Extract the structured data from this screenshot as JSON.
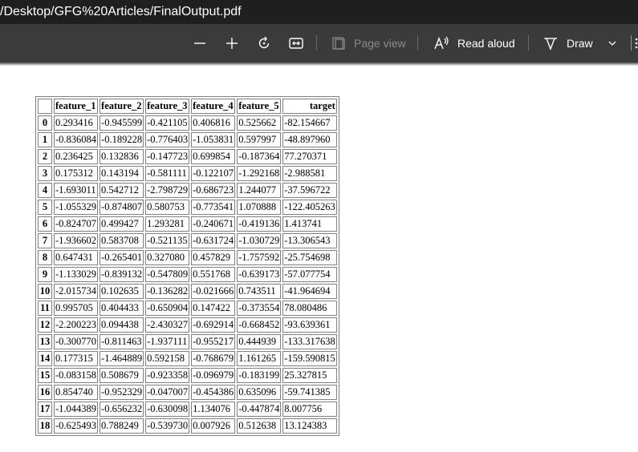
{
  "window": {
    "title": "/Desktop/GFG%20Articles/FinalOutput.pdf"
  },
  "toolbar": {
    "zoom_out_icon": "minus-icon",
    "zoom_in_icon": "plus-icon",
    "rotate_icon": "rotate-icon",
    "fit_icon": "fit-width-icon",
    "page_view_label": "Page view",
    "read_aloud_label": "Read aloud",
    "draw_label": "Draw"
  },
  "table": {
    "columns": [
      "",
      "feature_1",
      "feature_2",
      "feature_3",
      "feature_4",
      "feature_5",
      "target"
    ],
    "rows": [
      [
        "0",
        "0.293416",
        "-0.945599",
        "-0.421105",
        "0.406816",
        "0.525662",
        "-82.154667"
      ],
      [
        "1",
        "-0.836084",
        "-0.189228",
        "-0.776403",
        "-1.053831",
        "0.597997",
        "-48.897960"
      ],
      [
        "2",
        "0.236425",
        "0.132836",
        "-0.147723",
        "0.699854",
        "-0.187364",
        "77.270371"
      ],
      [
        "3",
        "0.175312",
        "0.143194",
        "-0.581111",
        "-0.122107",
        "-1.292168",
        "-2.988581"
      ],
      [
        "4",
        "-1.693011",
        "0.542712",
        "-2.798729",
        "-0.686723",
        "1.244077",
        "-37.596722"
      ],
      [
        "5",
        "-1.055329",
        "-0.874807",
        "0.580753",
        "-0.773541",
        "1.070888",
        "-122.405263"
      ],
      [
        "6",
        "-0.824707",
        "0.499427",
        "1.293281",
        "-0.240671",
        "-0.419136",
        "1.413741"
      ],
      [
        "7",
        "-1.936602",
        "0.583708",
        "-0.521135",
        "-0.631724",
        "-1.030729",
        "-13.306543"
      ],
      [
        "8",
        "0.647431",
        "-0.265401",
        "0.327080",
        "0.457829",
        "-1.757592",
        "-25.754698"
      ],
      [
        "9",
        "-1.133029",
        "-0.839132",
        "-0.547809",
        "0.551768",
        "-0.639173",
        "-57.077754"
      ],
      [
        "10",
        "-2.015734",
        "0.102635",
        "-0.136282",
        "-0.021666",
        "0.743511",
        "-41.964694"
      ],
      [
        "11",
        "0.995705",
        "0.404433",
        "-0.650904",
        "0.147422",
        "-0.373554",
        "78.080486"
      ],
      [
        "12",
        "-2.200223",
        "0.094438",
        "-2.430327",
        "-0.692914",
        "-0.668452",
        "-93.639361"
      ],
      [
        "13",
        "-0.300770",
        "-0.811463",
        "-1.937111",
        "-0.955217",
        "0.444939",
        "-133.317638"
      ],
      [
        "14",
        "0.177315",
        "-1.464889",
        "0.592158",
        "-0.768679",
        "1.161265",
        "-159.590815"
      ],
      [
        "15",
        "-0.083158",
        "0.508679",
        "-0.923358",
        "-0.096979",
        "-0.183199",
        "25.327815"
      ],
      [
        "16",
        "0.854740",
        "-0.952329",
        "-0.047007",
        "-0.454386",
        "0.635096",
        "-59.741385"
      ],
      [
        "17",
        "-1.044389",
        "-0.656232",
        "-0.630098",
        "1.134076",
        "-0.447874",
        "8.007756"
      ],
      [
        "18",
        "-0.625493",
        "0.788249",
        "-0.539730",
        "0.007926",
        "0.512638",
        "13.124383"
      ]
    ]
  }
}
